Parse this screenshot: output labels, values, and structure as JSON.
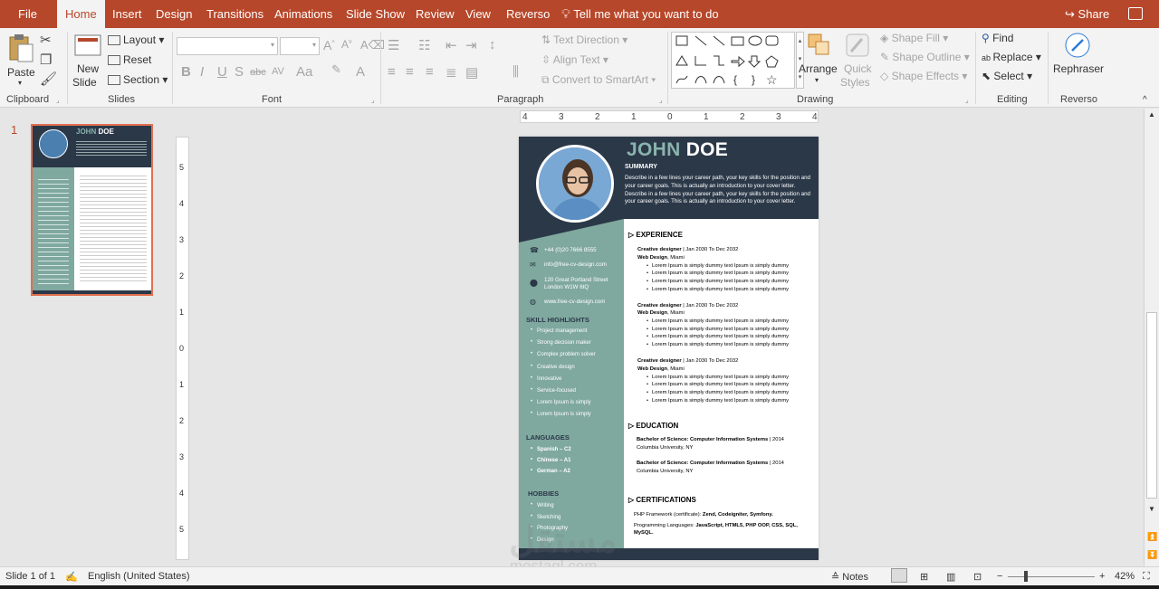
{
  "tabs": {
    "file": "File",
    "home": "Home",
    "insert": "Insert",
    "design": "Design",
    "transitions": "Transitions",
    "animations": "Animations",
    "slideshow": "Slide Show",
    "review": "Review",
    "view": "View",
    "reverso": "Reverso",
    "tell_me": "Tell me what you want to do",
    "share": "Share"
  },
  "ribbon": {
    "clipboard": {
      "paste": "Paste",
      "label": "Clipboard"
    },
    "slides": {
      "new_slide_1": "New",
      "new_slide_2": "Slide",
      "layout": "Layout",
      "reset": "Reset",
      "section": "Section",
      "label": "Slides"
    },
    "font": {
      "label": "Font",
      "bold": "B",
      "italic": "I",
      "underline": "U",
      "shadow": "S",
      "strike": "abc",
      "spacing": "AV",
      "case": "Aa",
      "color": "A"
    },
    "paragraph": {
      "label": "Paragraph",
      "text_direction": "Text Direction",
      "align_text": "Align Text",
      "smartart": "Convert to SmartArt"
    },
    "drawing": {
      "label": "Drawing",
      "arrange": "Arrange",
      "quick_styles_1": "Quick",
      "quick_styles_2": "Styles",
      "shape_fill": "Shape Fill",
      "shape_outline": "Shape Outline",
      "shape_effects": "Shape Effects"
    },
    "editing": {
      "label": "Editing",
      "find": "Find",
      "replace": "Replace",
      "select": "Select"
    },
    "reverso": {
      "rephraser": "Rephraser",
      "label": "Reverso"
    }
  },
  "thumbnail": {
    "number": "1"
  },
  "ruler": {
    "h_ticks": [
      "4",
      "3",
      "2",
      "1",
      "0",
      "1",
      "2",
      "3",
      "4"
    ],
    "v_ticks": [
      "5",
      "4",
      "3",
      "2",
      "1",
      "0",
      "1",
      "2",
      "3",
      "4",
      "5"
    ]
  },
  "resume": {
    "first_name": "JOHN",
    "last_name": "DOE",
    "summary_heading": "SUMMARY",
    "summary_text": "Describe in a few lines your career path, your key skills for the position and your career goals. This is actually an introduction to your cover letter. Describe in a few lines your career path, your key skills for the position and your career goals. This is actually an introduction to your cover letter.",
    "contact": {
      "phone": "+44 (0)20 7666 8555",
      "email": "info@free-cv-design.com",
      "address_1": "120 Great Portland Street",
      "address_2": "London W1W 6tQ",
      "website": "www.free-cv-design.com"
    },
    "skills_heading": "SKILL HIGHLIGHTS",
    "skills": [
      "Project management",
      "Strong decision maker",
      "Complex problem solver",
      "Creative design",
      "Innovative",
      "Service-focused",
      "Lorem Ipsum is simply",
      "Lorem Ipsum is simply"
    ],
    "languages_heading": "LANGUAGES",
    "languages": [
      "Spanish – C2",
      "Chinese – A1",
      "German – A2"
    ],
    "hobbies_heading": "HOBBIES",
    "hobbies": [
      "Writing",
      "Sketching",
      "Photography",
      "Design"
    ],
    "experience_heading": "EXPERIENCE",
    "jobs": [
      {
        "title": "Creative designer",
        "dates": " | Jan 2030 To Dec 2032",
        "company": "Web Design",
        "city": ", Miami"
      },
      {
        "title": "Creative designer",
        "dates": " | Jan 2030 To Dec 2032",
        "company": "Web Design",
        "city": ", Miami"
      },
      {
        "title": "Creative designer",
        "dates": " | Jan 2030 To Dec 2032",
        "company": "Web Design",
        "city": ", Miami"
      }
    ],
    "job_bullet": "Lorem Ipsum is simply dummy text Ipsum is simply dummy",
    "education_heading": "EDUCATION",
    "education": [
      {
        "degree": "Bachelor of Science: Computer Information Systems",
        "year": " | 2014",
        "school": "Columbia University, NY"
      },
      {
        "degree": "Bachelor of Science: Computer Information Systems",
        "year": " | 2014",
        "school": "Columbia University, NY"
      }
    ],
    "certifications_heading": "CERTIFICATIONS",
    "cert_1_a": "PHP Framework (certificate): ",
    "cert_1_b": "Zend, Codeigniter, Symfony.",
    "cert_2_a": "Programming Languages: ",
    "cert_2_b": "JavaScript, HTML5, PHP OOP, CSS, SQL, MySQL."
  },
  "watermark": {
    "arabic": "مستقل",
    "latin": "mostaql.com"
  },
  "status": {
    "slide": "Slide 1 of 1",
    "language": "English (United States)",
    "notes": "Notes",
    "zoom": "42%"
  },
  "colors": {
    "accent": "#b7472a",
    "resume_dark": "#2b3848",
    "resume_teal": "#7fa89f"
  }
}
